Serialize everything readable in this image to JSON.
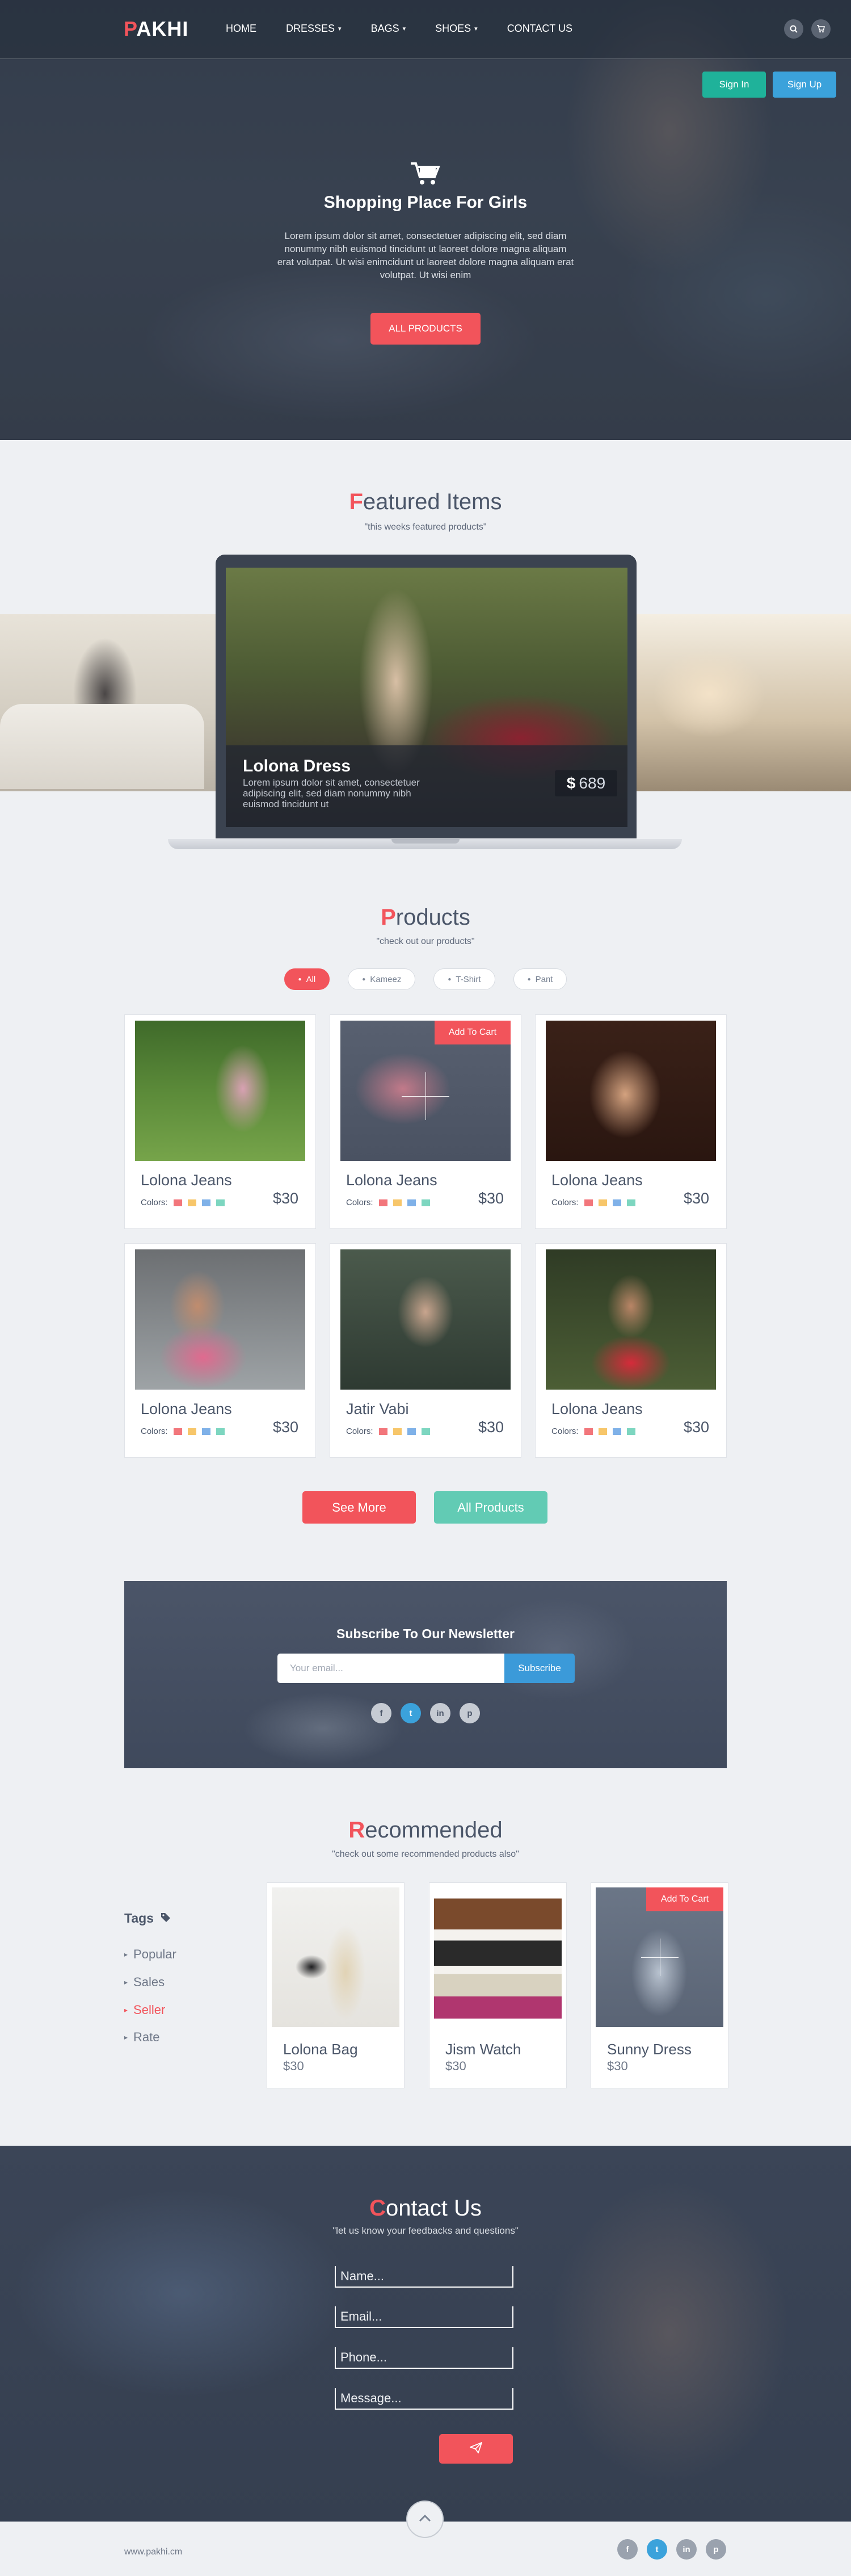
{
  "header": {
    "logo_first": "P",
    "logo_rest": "AKHI",
    "nav": [
      {
        "label": "HOME",
        "dropdown": false
      },
      {
        "label": "DRESSES",
        "dropdown": true
      },
      {
        "label": "BAGS",
        "dropdown": true
      },
      {
        "label": "SHOES",
        "dropdown": true
      },
      {
        "label": "CONTACT US",
        "dropdown": false
      }
    ],
    "icons": [
      "search-icon",
      "cart-icon"
    ],
    "signin_label": "Sign In",
    "signup_label": "Sign Up"
  },
  "hero": {
    "icon": "shopping-cart-icon",
    "title": "Shopping Place For Girls",
    "text": "Lorem ipsum dolor sit amet, consectetuer adipiscing elit, sed diam nonummy nibh euismod tincidunt ut laoreet dolore magna aliquam erat volutpat. Ut wisi enimcidunt ut laoreet dolore magna aliquam erat volutpat. Ut wisi enim",
    "button_label": "ALL PRODUCTS"
  },
  "featured": {
    "title_first": "F",
    "title_rest": "eatured Items",
    "subtitle": "\"this weeks featured products\"",
    "item_title": "Lolona Dress",
    "item_text": "Lorem ipsum dolor sit amet, consectetuer adipiscing elit, sed diam nonummy nibh euismod tincidunt ut",
    "currency": "$",
    "price": "689"
  },
  "products": {
    "title_first": "P",
    "title_rest": "roducts",
    "subtitle": "\"check out our products\"",
    "filters": [
      "All",
      "Kameez",
      "T-Shirt",
      "Pant"
    ],
    "active_filter": "All",
    "colors_label": "Colors:",
    "swatch_colors": [
      "#f2767b",
      "#f7c66a",
      "#7fb1e8",
      "#7dd6c0"
    ],
    "add_to_cart_label": "Add To Cart",
    "items": [
      {
        "name": "Lolona Jeans",
        "price": "$30"
      },
      {
        "name": "Lolona Jeans",
        "price": "$30"
      },
      {
        "name": "Lolona Jeans",
        "price": "$30"
      },
      {
        "name": "Lolona Jeans",
        "price": "$30"
      },
      {
        "name": "Jatir Vabi",
        "price": "$30"
      },
      {
        "name": "Lolona Jeans",
        "price": "$30"
      }
    ],
    "see_more_label": "See More",
    "all_products_label": "All Products"
  },
  "newsletter": {
    "title": "Subscribe To Our Newsletter",
    "email_placeholder": "Your email...",
    "button_label": "Subscribe",
    "social": [
      "f",
      "t",
      "in",
      "p"
    ]
  },
  "recommended": {
    "title_first": "R",
    "title_rest": "ecommended",
    "subtitle": "\"check out some recommended products also\"",
    "tags_title": "Tags",
    "tags": [
      "Popular",
      "Sales",
      "Seller",
      "Rate"
    ],
    "active_tag": "Seller",
    "add_to_cart_label": "Add To Cart",
    "items": [
      {
        "name": "Lolona Bag",
        "price": "$30"
      },
      {
        "name": "Jism Watch",
        "price": "$30"
      },
      {
        "name": "Sunny Dress",
        "price": "$30"
      }
    ]
  },
  "contact": {
    "title_first": "C",
    "title_rest": "ontact Us",
    "subtitle": "\"let us know your feedbacks and questions\"",
    "name_placeholder": "Name...",
    "email_placeholder": "Email...",
    "phone_placeholder": "Phone...",
    "message_placeholder": "Message...",
    "send_icon": "paper-plane-icon"
  },
  "footer": {
    "url": "www.pakhi.cm",
    "social": [
      "f",
      "t",
      "in",
      "p"
    ],
    "to_top_icon": "chevron-up-icon"
  },
  "colors": {
    "accent": "#f2545b",
    "teal": "#1fb29a",
    "mint": "#62cbb4",
    "blue": "#3ba2db",
    "dark": "#3b4350",
    "background": "#eef0f3"
  }
}
